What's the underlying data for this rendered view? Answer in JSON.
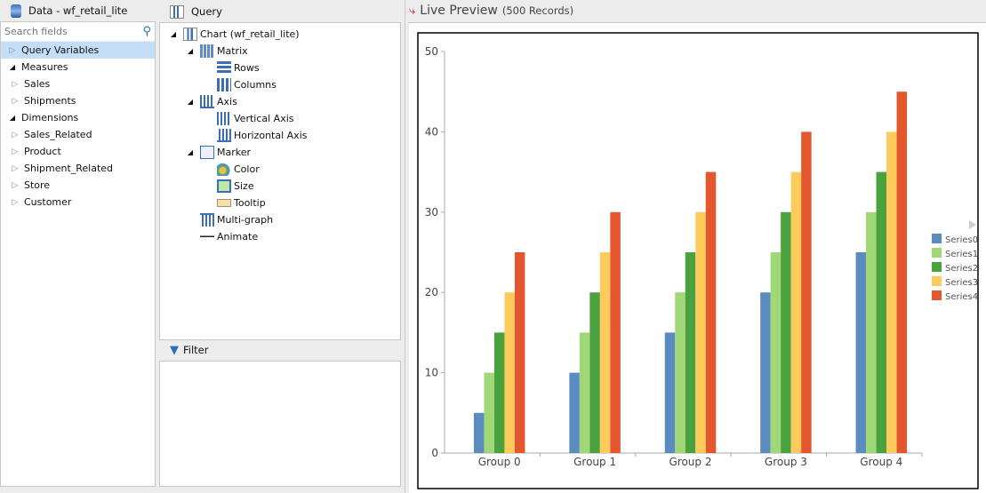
{
  "data_panel": {
    "title": "Data - wf_retail_lite",
    "search_placeholder": "Search fields",
    "items": [
      {
        "label": "Query Variables",
        "level": 0,
        "state": "closed",
        "selected": true
      },
      {
        "label": "Measures",
        "level": 0,
        "state": "open"
      },
      {
        "label": "Sales",
        "level": 1,
        "state": "closed"
      },
      {
        "label": "Shipments",
        "level": 1,
        "state": "closed"
      },
      {
        "label": "Dimensions",
        "level": 0,
        "state": "open"
      },
      {
        "label": "Sales_Related",
        "level": 1,
        "state": "closed"
      },
      {
        "label": "Product",
        "level": 1,
        "state": "closed"
      },
      {
        "label": "Shipment_Related",
        "level": 1,
        "state": "closed"
      },
      {
        "label": "Store",
        "level": 1,
        "state": "closed"
      },
      {
        "label": "Customer",
        "level": 1,
        "state": "closed"
      }
    ]
  },
  "query_panel": {
    "title": "Query",
    "items": [
      {
        "label": "Chart (wf_retail_lite)",
        "level": 0,
        "icon": "chart-icon",
        "open": true
      },
      {
        "label": "Matrix",
        "level": 1,
        "icon": "matrix-icon",
        "open": true
      },
      {
        "label": "Rows",
        "level": 2,
        "icon": "rows-icon"
      },
      {
        "label": "Columns",
        "level": 2,
        "icon": "columns-icon"
      },
      {
        "label": "Axis",
        "level": 1,
        "icon": "axis-icon",
        "open": true
      },
      {
        "label": "Vertical Axis",
        "level": 2,
        "icon": "vertical-axis-icon"
      },
      {
        "label": "Horizontal Axis",
        "level": 2,
        "icon": "horizontal-axis-icon"
      },
      {
        "label": "Marker",
        "level": 1,
        "icon": "marker-icon",
        "open": true
      },
      {
        "label": "Color",
        "level": 2,
        "icon": "color-icon"
      },
      {
        "label": "Size",
        "level": 2,
        "icon": "size-icon"
      },
      {
        "label": "Tooltip",
        "level": 2,
        "icon": "tooltip-icon"
      },
      {
        "label": "Multi-graph",
        "level": 1,
        "icon": "multigraph-icon"
      },
      {
        "label": "Animate",
        "level": 1,
        "icon": "animate-icon"
      }
    ]
  },
  "filter_panel": {
    "title": "Filter"
  },
  "preview": {
    "title": "Live Preview",
    "records": "(500 Records)"
  },
  "chart_data": {
    "type": "bar",
    "categories": [
      "Group 0",
      "Group 1",
      "Group 2",
      "Group 3",
      "Group 4"
    ],
    "series": [
      {
        "name": "Series0",
        "color": "#5b8cc0",
        "values": [
          5,
          10,
          15,
          20,
          25
        ]
      },
      {
        "name": "Series1",
        "color": "#a0d878",
        "values": [
          10,
          15,
          20,
          25,
          30
        ]
      },
      {
        "name": "Series2",
        "color": "#4aa23e",
        "values": [
          15,
          20,
          25,
          30,
          35
        ]
      },
      {
        "name": "Series3",
        "color": "#fdcb5c",
        "values": [
          20,
          25,
          30,
          35,
          40
        ]
      },
      {
        "name": "Series4",
        "color": "#e4572e",
        "values": [
          25,
          30,
          35,
          40,
          45
        ]
      }
    ],
    "ylim": [
      0,
      50
    ],
    "yticks": [
      "0",
      "10",
      "20",
      "30",
      "40",
      "50"
    ],
    "grid": false,
    "legend": "right"
  }
}
